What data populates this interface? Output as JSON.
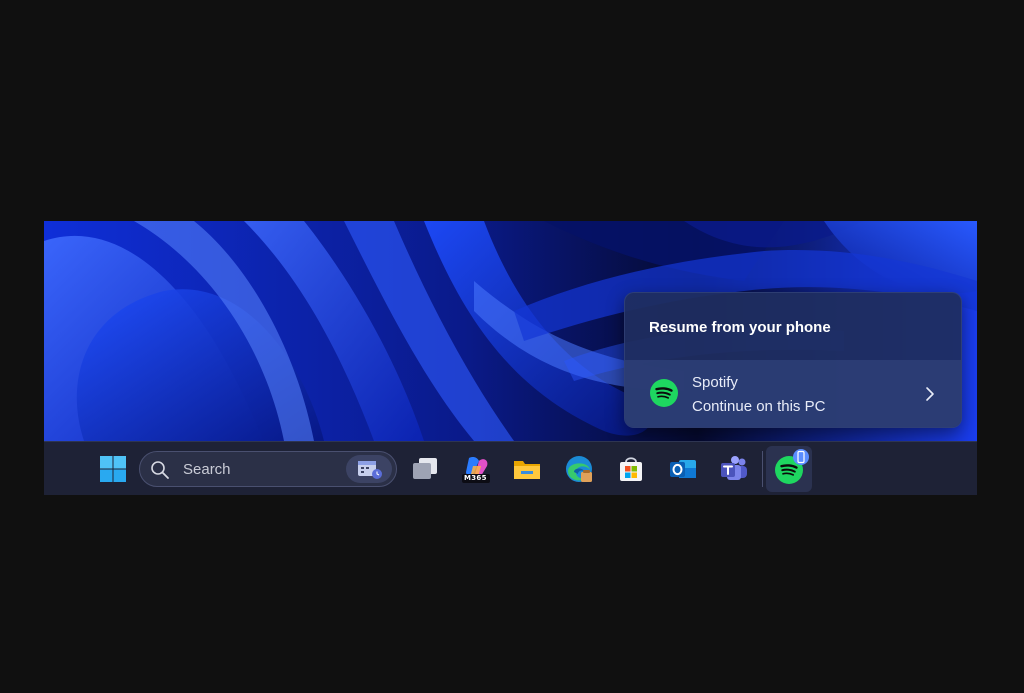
{
  "popup": {
    "title": "Resume from your phone",
    "app_name": "Spotify",
    "action": "Continue on this PC"
  },
  "taskbar": {
    "search_placeholder": "Search",
    "apps": [
      {
        "name": "start",
        "icon": "windows-logo-icon"
      },
      {
        "name": "task-view",
        "icon": "task-view-icon"
      },
      {
        "name": "microsoft-365",
        "icon": "m365-icon",
        "label": "M365"
      },
      {
        "name": "file-explorer",
        "icon": "folder-icon"
      },
      {
        "name": "edge",
        "icon": "edge-icon"
      },
      {
        "name": "microsoft-store",
        "icon": "store-icon"
      },
      {
        "name": "outlook",
        "icon": "outlook-icon"
      },
      {
        "name": "teams",
        "icon": "teams-icon"
      },
      {
        "name": "spotify",
        "icon": "spotify-icon",
        "active": true
      }
    ]
  },
  "colors": {
    "spotify_green": "#1ed760",
    "accent_blue": "#1a4cff",
    "taskbar_bg": "#1e2236"
  }
}
